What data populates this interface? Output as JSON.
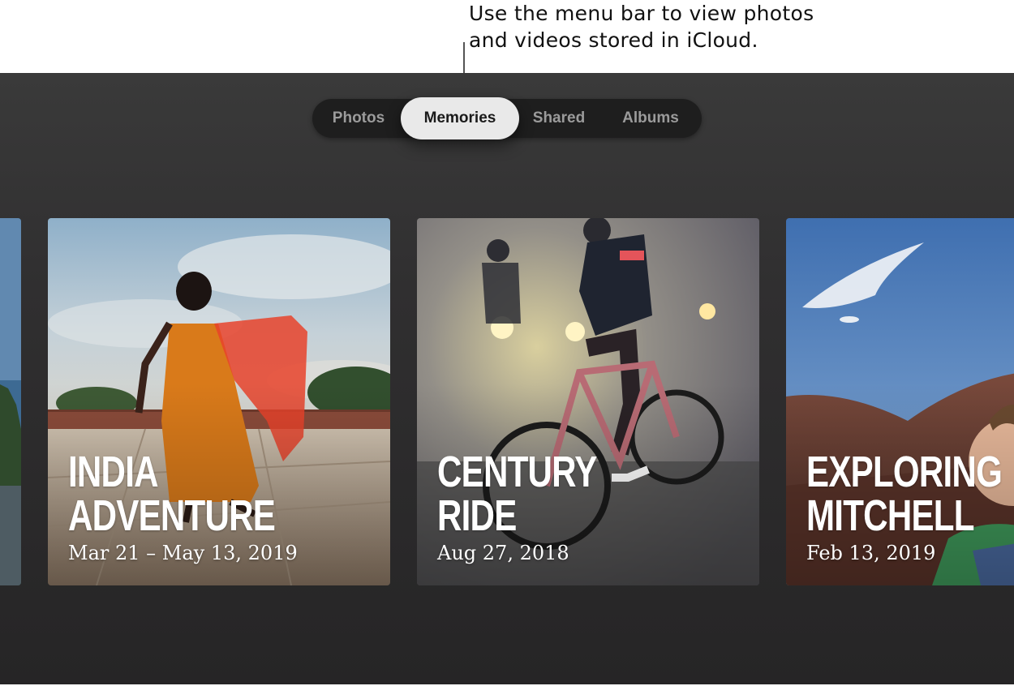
{
  "callout": {
    "line1": "Use the menu bar to view photos",
    "line2": "and videos stored in iCloud."
  },
  "menubar": {
    "tabs": [
      {
        "label": "Photos",
        "active": false
      },
      {
        "label": "Memories",
        "active": true
      },
      {
        "label": "Shared",
        "active": false
      },
      {
        "label": "Albums",
        "active": false
      }
    ]
  },
  "memories": [
    {
      "title_line1": "India",
      "title_line2": "Adventure",
      "date": "Mar 21 – May 13, 2019"
    },
    {
      "title_line1": "Century",
      "title_line2": "Ride",
      "date": "Aug 27, 2018"
    },
    {
      "title_line1": "Exploring",
      "title_line2": "Mitchell",
      "date": "Feb 13, 2019"
    }
  ],
  "colors": {
    "screen_bg": "#302f30",
    "menubar_bg": "#1e1e1e",
    "active_tab_bg": "#e9e9e9",
    "inactive_tab_text": "#9b9b9b"
  }
}
